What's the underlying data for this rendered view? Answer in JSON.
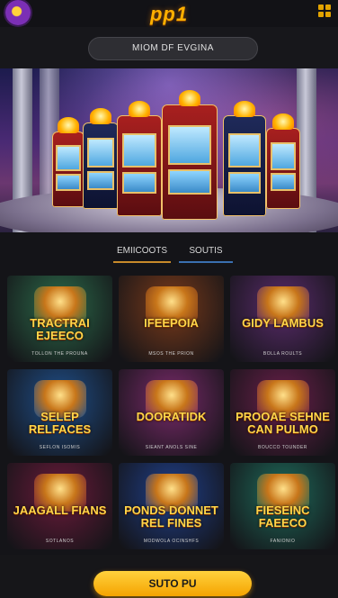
{
  "app": {
    "logo_text": "pp1"
  },
  "search": {
    "value": "MIOM DF EVGINA"
  },
  "tabs": [
    {
      "label": "EMIICOOTS"
    },
    {
      "label": "SOUTIS"
    }
  ],
  "games": [
    {
      "title": "TRACTRAI EJEECO",
      "subtitle": "TOLLON THE PROUNA",
      "theme": "#2c6b4a"
    },
    {
      "title": "IFEEPOIA",
      "subtitle": "MSOS THE PRION",
      "theme": "#7a3a1a"
    },
    {
      "title": "GIDY LAMBUS",
      "subtitle": "BOLLA ROULTS",
      "theme": "#5a2b6b"
    },
    {
      "title": "SELEP RELFACES",
      "subtitle": "SEFLON ISOMIS",
      "theme": "#1f4f8a"
    },
    {
      "title": "DOORATIDK",
      "subtitle": "SIEANT ANOLS SINE",
      "theme": "#7a2a6a"
    },
    {
      "title": "PROOAE SEHNE CAN PULMO",
      "subtitle": "BOUCCO TOUNDER",
      "theme": "#6a1f4a"
    },
    {
      "title": "JAAGALL FIANS",
      "subtitle": "SOTLANOS",
      "theme": "#6a1a3a"
    },
    {
      "title": "PONDS DONNET REL FINES",
      "subtitle": "MODWOLA OCINSHFS",
      "theme": "#1f3f8a"
    },
    {
      "title": "FIESEINC FAEECO",
      "subtitle": "FANIONIO",
      "theme": "#1e6a5a"
    }
  ],
  "footer": {
    "play_label": "SUTO PU"
  },
  "colors": {
    "accent": "#ffb000",
    "background": "#141418"
  }
}
